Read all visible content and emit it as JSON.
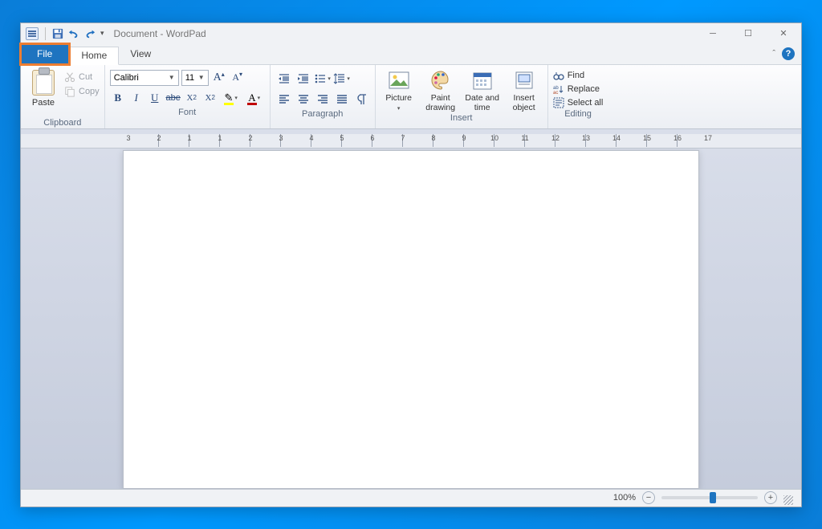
{
  "title": "Document - WordPad",
  "tabs": {
    "file": "File",
    "home": "Home",
    "view": "View"
  },
  "clipboard": {
    "paste": "Paste",
    "cut": "Cut",
    "copy": "Copy",
    "label": "Clipboard"
  },
  "font": {
    "name": "Calibri",
    "size": "11",
    "label": "Font"
  },
  "paragraph": {
    "label": "Paragraph"
  },
  "insert": {
    "picture": "Picture",
    "paint": "Paint\ndrawing",
    "date": "Date and\ntime",
    "object": "Insert\nobject",
    "label": "Insert"
  },
  "editing": {
    "find": "Find",
    "replace": "Replace",
    "selectall": "Select all",
    "label": "Editing"
  },
  "ruler_numbers": [
    "3",
    "2",
    "1",
    "1",
    "2",
    "3",
    "4",
    "5",
    "6",
    "7",
    "8",
    "9",
    "10",
    "11",
    "12",
    "13",
    "14",
    "15",
    "16",
    "17"
  ],
  "status": {
    "zoom": "100%"
  }
}
